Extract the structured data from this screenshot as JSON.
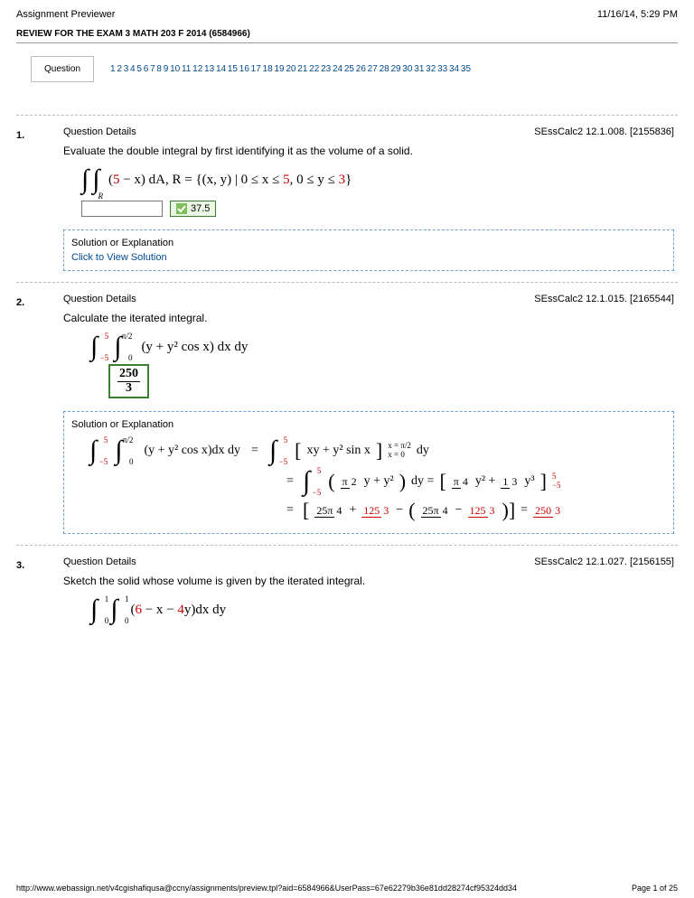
{
  "header": {
    "title": "Assignment Previewer",
    "datetime": "11/16/14, 5:29 PM"
  },
  "review_title": "REVIEW FOR THE EXAM 3 MATH 203 F 2014 (6584966)",
  "question_nav_label": "Question",
  "nav_numbers": "1 2 3 4 5 6 7 8 9 10 11 12 13 14 15 16 17 18 19 20 21 22 23 24 25 26 27 28 29 30 31 32 33 34 35",
  "q1": {
    "num": "1.",
    "details": "Question Details",
    "source": "SEssCalc2 12.1.008. [2155836]",
    "prompt": "Evaluate the double integral by first identifying it as the volume of a solid.",
    "expr_prefix": "(",
    "expr_five": "5",
    "expr_mid": " − x) dA, R = {(x, y) | 0 ≤ x ≤ ",
    "expr_five2": "5",
    "expr_mid2": ", 0 ≤ y ≤ ",
    "expr_three": "3",
    "expr_end": "}",
    "answer": "37.5",
    "sol_title": "Solution or Explanation",
    "sol_link": "Click to View Solution"
  },
  "q2": {
    "num": "2.",
    "details": "Question Details",
    "source": "SEssCalc2 12.1.015. [2165544]",
    "prompt": "Calculate the iterated integral.",
    "outer_top": "5",
    "outer_bot": "−5",
    "inner_top": "π/2",
    "inner_bot": "0",
    "integrand": "(y + y² cos x) dx dy",
    "ans_top": "250",
    "ans_bot": "3",
    "sol_title": "Solution or Explanation",
    "step1_left_int": "(y + y² cos x)dx dy",
    "step1_eq": "=",
    "step1_right_a": "xy + y² sin x",
    "step1_right_lim_top": "x = π/2",
    "step1_right_lim_bot": "x = 0",
    "step1_right_b": " dy",
    "step2_int": "y + y²",
    "step2_int_suffix": "dy =",
    "step2_rhs_a": "y² + ",
    "step2_rhs_b": "y³",
    "step3_lhs_a": "25π",
    "step3_lhs_b": "4",
    "step3_lhs_c": "125",
    "step3_lhs_d": "3",
    "step3_final_top": "250",
    "step3_final_bot": "3"
  },
  "q3": {
    "num": "3.",
    "details": "Question Details",
    "source": "SEssCalc2 12.1.027. [2156155]",
    "prompt": "Sketch the solid whose volume is given by the iterated integral.",
    "outer_top": "1",
    "outer_bot": "0",
    "inner_top": "1",
    "inner_bot": "0",
    "expr_prefix": "(",
    "expr_six": "6",
    "expr_mid": " − x − ",
    "expr_four": "4",
    "expr_end": "y)dx dy"
  },
  "footer": {
    "url": "http://www.webassign.net/v4cgishafiqusa@ccny/assignments/preview.tpl?aid=6584966&UserPass=67e62279b36e81dd28274cf95324dd34",
    "page": "Page 1 of 25"
  }
}
